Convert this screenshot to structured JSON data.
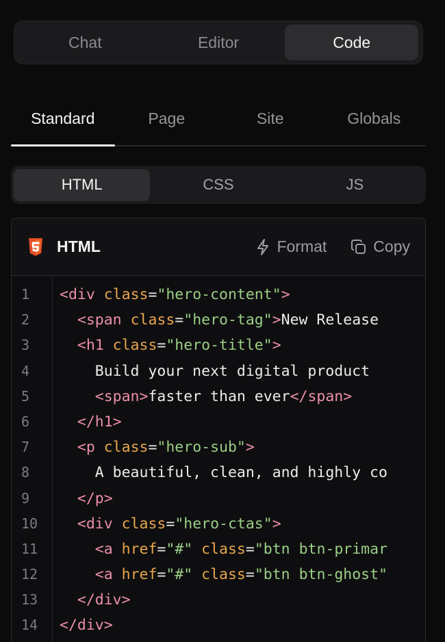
{
  "modes": [
    {
      "label": "Chat",
      "active": false
    },
    {
      "label": "Editor",
      "active": false
    },
    {
      "label": "Code",
      "active": true
    }
  ],
  "scopes": [
    {
      "label": "Standard",
      "active": true
    },
    {
      "label": "Page",
      "active": false
    },
    {
      "label": "Site",
      "active": false
    },
    {
      "label": "Globals",
      "active": false
    }
  ],
  "languages": [
    {
      "label": "HTML",
      "active": true
    },
    {
      "label": "CSS",
      "active": false
    },
    {
      "label": "JS",
      "active": false
    }
  ],
  "panel": {
    "title": "HTML",
    "icon": "html5-icon",
    "format_label": "Format",
    "copy_label": "Copy"
  },
  "code_lines": [
    [
      [
        "tag",
        "<div "
      ],
      [
        "attr",
        "class"
      ],
      [
        "txt",
        "="
      ],
      [
        "str",
        "\"hero-content\""
      ],
      [
        "tag",
        ">"
      ]
    ],
    [
      [
        "txt",
        "  "
      ],
      [
        "tag",
        "<span "
      ],
      [
        "attr",
        "class"
      ],
      [
        "txt",
        "="
      ],
      [
        "str",
        "\"hero-tag\""
      ],
      [
        "tag",
        ">"
      ],
      [
        "txt",
        "New Release"
      ]
    ],
    [
      [
        "txt",
        "  "
      ],
      [
        "tag",
        "<h1 "
      ],
      [
        "attr",
        "class"
      ],
      [
        "txt",
        "="
      ],
      [
        "str",
        "\"hero-title\""
      ],
      [
        "tag",
        ">"
      ]
    ],
    [
      [
        "txt",
        "    Build your next digital product"
      ]
    ],
    [
      [
        "txt",
        "    "
      ],
      [
        "tag",
        "<span>"
      ],
      [
        "txt",
        "faster than ever"
      ],
      [
        "tag",
        "</span>"
      ]
    ],
    [
      [
        "txt",
        "  "
      ],
      [
        "tag",
        "</h1>"
      ]
    ],
    [
      [
        "txt",
        "  "
      ],
      [
        "tag",
        "<p "
      ],
      [
        "attr",
        "class"
      ],
      [
        "txt",
        "="
      ],
      [
        "str",
        "\"hero-sub\""
      ],
      [
        "tag",
        ">"
      ]
    ],
    [
      [
        "txt",
        "    A beautiful, clean, and highly co"
      ]
    ],
    [
      [
        "txt",
        "  "
      ],
      [
        "tag",
        "</p>"
      ]
    ],
    [
      [
        "txt",
        "  "
      ],
      [
        "tag",
        "<div "
      ],
      [
        "attr",
        "class"
      ],
      [
        "txt",
        "="
      ],
      [
        "str",
        "\"hero-ctas\""
      ],
      [
        "tag",
        ">"
      ]
    ],
    [
      [
        "txt",
        "    "
      ],
      [
        "tag",
        "<a "
      ],
      [
        "attr",
        "href"
      ],
      [
        "txt",
        "="
      ],
      [
        "str",
        "\"#\""
      ],
      [
        "txt",
        " "
      ],
      [
        "attr",
        "class"
      ],
      [
        "txt",
        "="
      ],
      [
        "str",
        "\"btn btn-primar"
      ]
    ],
    [
      [
        "txt",
        "    "
      ],
      [
        "tag",
        "<a "
      ],
      [
        "attr",
        "href"
      ],
      [
        "txt",
        "="
      ],
      [
        "str",
        "\"#\""
      ],
      [
        "txt",
        " "
      ],
      [
        "attr",
        "class"
      ],
      [
        "txt",
        "="
      ],
      [
        "str",
        "\"btn btn-ghost\""
      ]
    ],
    [
      [
        "txt",
        "  "
      ],
      [
        "tag",
        "</div>"
      ]
    ],
    [
      [
        "tag",
        "</div>"
      ]
    ]
  ],
  "colors": {
    "tag": "#ec8fa8",
    "attr": "#e9a64e",
    "string": "#9bcf86",
    "html5_badge": "#e44d26"
  }
}
